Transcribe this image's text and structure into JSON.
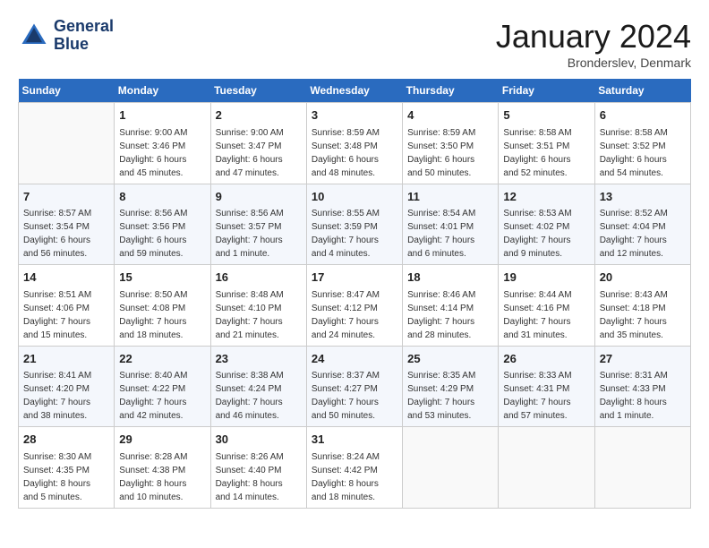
{
  "header": {
    "logo_line1": "General",
    "logo_line2": "Blue",
    "month_title": "January 2024",
    "subtitle": "Bronderslev, Denmark"
  },
  "columns": [
    "Sunday",
    "Monday",
    "Tuesday",
    "Wednesday",
    "Thursday",
    "Friday",
    "Saturday"
  ],
  "weeks": [
    [
      {
        "day": "",
        "info": ""
      },
      {
        "day": "1",
        "info": "Sunrise: 9:00 AM\nSunset: 3:46 PM\nDaylight: 6 hours\nand 45 minutes."
      },
      {
        "day": "2",
        "info": "Sunrise: 9:00 AM\nSunset: 3:47 PM\nDaylight: 6 hours\nand 47 minutes."
      },
      {
        "day": "3",
        "info": "Sunrise: 8:59 AM\nSunset: 3:48 PM\nDaylight: 6 hours\nand 48 minutes."
      },
      {
        "day": "4",
        "info": "Sunrise: 8:59 AM\nSunset: 3:50 PM\nDaylight: 6 hours\nand 50 minutes."
      },
      {
        "day": "5",
        "info": "Sunrise: 8:58 AM\nSunset: 3:51 PM\nDaylight: 6 hours\nand 52 minutes."
      },
      {
        "day": "6",
        "info": "Sunrise: 8:58 AM\nSunset: 3:52 PM\nDaylight: 6 hours\nand 54 minutes."
      }
    ],
    [
      {
        "day": "7",
        "info": "Sunrise: 8:57 AM\nSunset: 3:54 PM\nDaylight: 6 hours\nand 56 minutes."
      },
      {
        "day": "8",
        "info": "Sunrise: 8:56 AM\nSunset: 3:56 PM\nDaylight: 6 hours\nand 59 minutes."
      },
      {
        "day": "9",
        "info": "Sunrise: 8:56 AM\nSunset: 3:57 PM\nDaylight: 7 hours\nand 1 minute."
      },
      {
        "day": "10",
        "info": "Sunrise: 8:55 AM\nSunset: 3:59 PM\nDaylight: 7 hours\nand 4 minutes."
      },
      {
        "day": "11",
        "info": "Sunrise: 8:54 AM\nSunset: 4:01 PM\nDaylight: 7 hours\nand 6 minutes."
      },
      {
        "day": "12",
        "info": "Sunrise: 8:53 AM\nSunset: 4:02 PM\nDaylight: 7 hours\nand 9 minutes."
      },
      {
        "day": "13",
        "info": "Sunrise: 8:52 AM\nSunset: 4:04 PM\nDaylight: 7 hours\nand 12 minutes."
      }
    ],
    [
      {
        "day": "14",
        "info": "Sunrise: 8:51 AM\nSunset: 4:06 PM\nDaylight: 7 hours\nand 15 minutes."
      },
      {
        "day": "15",
        "info": "Sunrise: 8:50 AM\nSunset: 4:08 PM\nDaylight: 7 hours\nand 18 minutes."
      },
      {
        "day": "16",
        "info": "Sunrise: 8:48 AM\nSunset: 4:10 PM\nDaylight: 7 hours\nand 21 minutes."
      },
      {
        "day": "17",
        "info": "Sunrise: 8:47 AM\nSunset: 4:12 PM\nDaylight: 7 hours\nand 24 minutes."
      },
      {
        "day": "18",
        "info": "Sunrise: 8:46 AM\nSunset: 4:14 PM\nDaylight: 7 hours\nand 28 minutes."
      },
      {
        "day": "19",
        "info": "Sunrise: 8:44 AM\nSunset: 4:16 PM\nDaylight: 7 hours\nand 31 minutes."
      },
      {
        "day": "20",
        "info": "Sunrise: 8:43 AM\nSunset: 4:18 PM\nDaylight: 7 hours\nand 35 minutes."
      }
    ],
    [
      {
        "day": "21",
        "info": "Sunrise: 8:41 AM\nSunset: 4:20 PM\nDaylight: 7 hours\nand 38 minutes."
      },
      {
        "day": "22",
        "info": "Sunrise: 8:40 AM\nSunset: 4:22 PM\nDaylight: 7 hours\nand 42 minutes."
      },
      {
        "day": "23",
        "info": "Sunrise: 8:38 AM\nSunset: 4:24 PM\nDaylight: 7 hours\nand 46 minutes."
      },
      {
        "day": "24",
        "info": "Sunrise: 8:37 AM\nSunset: 4:27 PM\nDaylight: 7 hours\nand 50 minutes."
      },
      {
        "day": "25",
        "info": "Sunrise: 8:35 AM\nSunset: 4:29 PM\nDaylight: 7 hours\nand 53 minutes."
      },
      {
        "day": "26",
        "info": "Sunrise: 8:33 AM\nSunset: 4:31 PM\nDaylight: 7 hours\nand 57 minutes."
      },
      {
        "day": "27",
        "info": "Sunrise: 8:31 AM\nSunset: 4:33 PM\nDaylight: 8 hours\nand 1 minute."
      }
    ],
    [
      {
        "day": "28",
        "info": "Sunrise: 8:30 AM\nSunset: 4:35 PM\nDaylight: 8 hours\nand 5 minutes."
      },
      {
        "day": "29",
        "info": "Sunrise: 8:28 AM\nSunset: 4:38 PM\nDaylight: 8 hours\nand 10 minutes."
      },
      {
        "day": "30",
        "info": "Sunrise: 8:26 AM\nSunset: 4:40 PM\nDaylight: 8 hours\nand 14 minutes."
      },
      {
        "day": "31",
        "info": "Sunrise: 8:24 AM\nSunset: 4:42 PM\nDaylight: 8 hours\nand 18 minutes."
      },
      {
        "day": "",
        "info": ""
      },
      {
        "day": "",
        "info": ""
      },
      {
        "day": "",
        "info": ""
      }
    ]
  ]
}
